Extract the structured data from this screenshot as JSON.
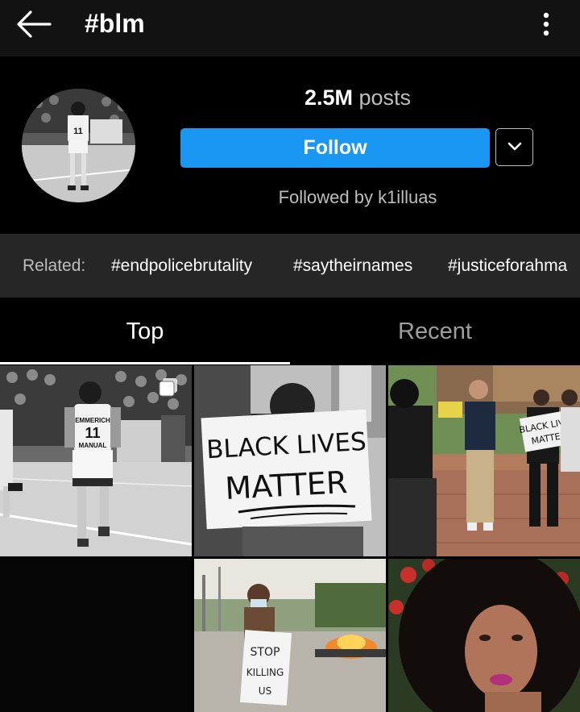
{
  "topbar": {
    "title": "#blm",
    "back_icon": "arrow-left-icon",
    "menu_icon": "vertical-ellipsis-icon"
  },
  "header": {
    "posts_count": "2.5M",
    "posts_label": "posts",
    "follow_label": "Follow",
    "dropdown_icon": "chevron-down-icon",
    "followed_by": "Followed by k1illuas"
  },
  "related": {
    "label": "Related:",
    "tags": [
      "#endpolicebrutality",
      "#saytheirnames",
      "#justiceforahma"
    ]
  },
  "tabs": {
    "top": "Top",
    "recent": "Recent",
    "active": "Top"
  },
  "grid": {
    "posts": [
      {
        "kind": "photo",
        "multi_icon": "multiple-posts-icon",
        "jersey_number": "11",
        "jersey_text": "EMMERICH MANUAL"
      },
      {
        "kind": "photo",
        "sign_line1": "BLACK LIVES",
        "sign_line2": "MATTER"
      },
      {
        "kind": "photo",
        "sign_line1": "BLACK LIVES",
        "sign_line2": "MATTER"
      },
      {
        "kind": "photo-dark"
      },
      {
        "kind": "photo",
        "sign_line1": "STOP",
        "sign_line2": "KILLING",
        "sign_line3": "US"
      },
      {
        "kind": "photo"
      }
    ]
  },
  "colors": {
    "accent": "#1a96f3",
    "background": "#000000",
    "bar": "#121212",
    "related_bg": "#262626"
  }
}
